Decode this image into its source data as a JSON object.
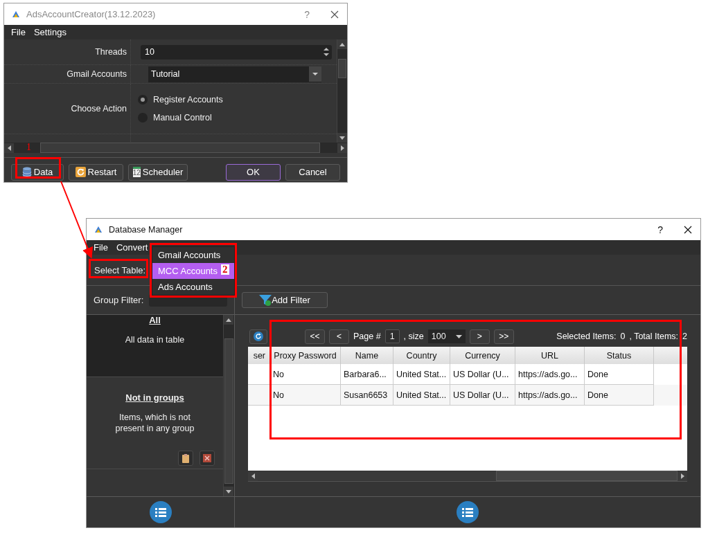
{
  "main_window": {
    "title": "AdsAccountCreator(13.12.2023)",
    "help": "?",
    "menu": [
      "File",
      "Settings"
    ],
    "fields": [
      {
        "kind": "spin",
        "label": "Threads",
        "value": "10"
      },
      {
        "kind": "combo",
        "label": "Gmail Accounts",
        "value": "Tutorial"
      },
      {
        "kind": "radio",
        "label": "Choose Action",
        "options": [
          {
            "label": "Register Accounts",
            "selected": true
          },
          {
            "label": "Manual Control",
            "selected": false
          }
        ]
      }
    ],
    "buttons": [
      {
        "label": "Data",
        "default": false
      },
      {
        "label": "Restart",
        "default": false
      },
      {
        "label": "Scheduler",
        "icon_text": "12",
        "default": false
      },
      {
        "label": "OK",
        "default": true
      },
      {
        "label": "Cancel",
        "default": false
      }
    ]
  },
  "db_window": {
    "title": "Database Manager",
    "help": "?",
    "menu": [
      "File",
      "Convert"
    ],
    "select_table_label": "Select Table:",
    "table_menu": [
      {
        "label": "Gmail Accounts",
        "selected": false
      },
      {
        "label": "MCC Accounts",
        "selected": true
      },
      {
        "label": "Ads Accounts",
        "selected": false
      }
    ],
    "group_filter_label": "Group Filter:",
    "groups": [
      {
        "title": "All",
        "description": "All data in table",
        "selected": true,
        "actions": false
      },
      {
        "title": "Not in groups",
        "description": "Items, which is not present in any group",
        "selected": false,
        "actions": true
      }
    ],
    "add_filter": "Add Filter",
    "pager": {
      "first": "<<",
      "prev": "<",
      "page_label": "Page #",
      "page": "1",
      "size_label": ", size",
      "size": "100",
      "next": ">",
      "last": ">>",
      "selected_label": "Selected Items:",
      "selected_count": "0",
      "total_label": ", Total Items:",
      "total_count": "2"
    },
    "table": {
      "columns": [
        "ser",
        "Proxy Password",
        "Name",
        "Country",
        "Currency",
        "URL",
        "Status"
      ],
      "rows": [
        {
          "cells": [
            "",
            "No",
            "Barbara6...",
            "United Stat...",
            "US Dollar (U...",
            "https://ads.go...",
            "Done"
          ]
        },
        {
          "cells": [
            "",
            "No",
            "Susan6653",
            "United Stat...",
            "US Dollar (U...",
            "https://ads.go...",
            "Done"
          ]
        }
      ]
    }
  },
  "annotations": {
    "step_1": "1",
    "step_2": "2"
  }
}
